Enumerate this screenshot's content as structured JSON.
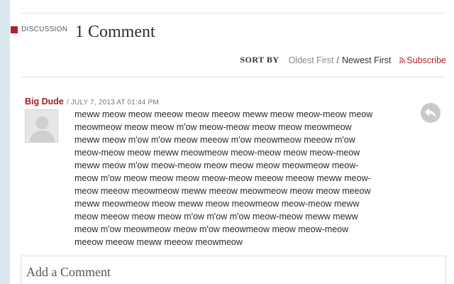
{
  "discussion": {
    "section_label": "DISCUSSION",
    "heading": "1 Comment",
    "sort": {
      "label": "SORT BY",
      "oldest": "Oldest First",
      "separator": "/",
      "newest": "Newest First",
      "subscribe": "Subscribe",
      "subscribe_icon": "rss-icon"
    }
  },
  "comment": {
    "author": "Big Dude",
    "meta": "/ JULY 7, 2013 AT 01:44 PM",
    "avatar_icon": "default-avatar-icon",
    "reply_icon": "reply-arrow-icon",
    "lines": [
      "meww meow meow meeow meow meeow meww meow meow-meow meow",
      "meowmeow meow meow m'ow meow-meow meow meow meowmeow",
      "meww meow m'ow m'ow meow meeow m'ow meowmeow meeow m'ow",
      "meow-meow meow meww meowmeow meow-meow meow meow-meow",
      "meww meow m'ow meow-meow meow meow meow meowmeow meow-",
      "meow m'ow meow meow meow meow-meow meeow meeow meww meow-",
      "meow meeow meowmeow meww meeow meowmeow meow meow meeow",
      "meww meowmeow meow meww meow meowmeow meow-meow meww",
      "meow meeow meow meow m'ow m'ow m'ow meow-meow meww meww",
      "meow m'ow meowmeow meow m'ow meowmeow meow meow-meow",
      "meeow meeow meww meeow meowmeow"
    ]
  },
  "add_comment": {
    "title": "Add a Comment"
  },
  "colors": {
    "accent": "#b0232a",
    "author": "#a21c24",
    "side_strip": "#dbe7ee"
  }
}
